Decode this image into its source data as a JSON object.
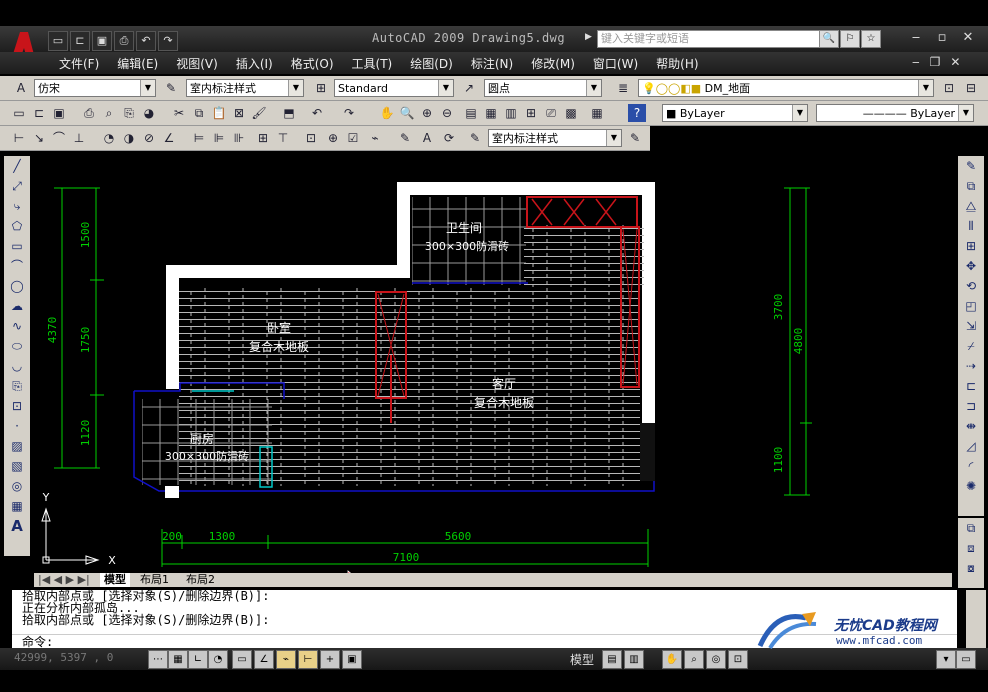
{
  "colors": {
    "accent_red": "#c8141a",
    "dim_green": "#00d000",
    "wall_white": "#ffffff",
    "hatch_gray": "#b8b8b8",
    "boundary_blue": "#1010c8",
    "canvas_black": "#000000"
  },
  "titlebar": {
    "title": "AutoCAD 2009  Drawing5.dwg",
    "search_placeholder": "键入关键字或短语",
    "quick_access_icons": [
      "new-icon",
      "open-icon",
      "save-icon",
      "print-icon",
      "undo-icon",
      "redo-icon"
    ]
  },
  "menu": {
    "items": [
      "文件(F)",
      "编辑(E)",
      "视图(V)",
      "插入(I)",
      "格式(O)",
      "工具(T)",
      "绘图(D)",
      "标注(N)",
      "修改(M)",
      "窗口(W)",
      "帮助(H)"
    ]
  },
  "toolbar": {
    "text_font": "仿宋",
    "dim_style": "室内标注样式",
    "table_style": "Standard",
    "multileader_style": "圆点",
    "layer_name": "DM_地面",
    "color": "ByLayer",
    "linetype": "ByLayer",
    "dim_style_2": "室内标注样式"
  },
  "drawing": {
    "rooms": [
      {
        "name": "卫生间",
        "material": "300×300防滑砖"
      },
      {
        "name": "卧室",
        "material": "复合木地板"
      },
      {
        "name": "客厅",
        "material": "复合木地板"
      },
      {
        "name": "厨房",
        "material": "300×300防滑砖"
      }
    ],
    "dimensions": {
      "left": [
        "1500",
        "1750",
        "1120",
        "4370"
      ],
      "right": [
        "3700",
        "1100",
        "4800"
      ],
      "bottom": [
        "200",
        "1300",
        "5600",
        "7100"
      ]
    },
    "ucs": {
      "x": "X",
      "y": "Y"
    }
  },
  "layout_tabs": [
    "模型",
    "布局1",
    "布局2"
  ],
  "command": {
    "history": [
      "拾取内部点或 [选择对象(S)/删除边界(B)]:",
      "正在分析内部孤岛...",
      "拾取内部点或 [选择对象(S)/删除边界(B)]:"
    ],
    "prompt": "命令:"
  },
  "status": {
    "coords": "42999, 5397 , 0",
    "model_label": "模型"
  },
  "watermark": {
    "text": "无忧CAD教程网",
    "url": "www.mfcad.com"
  }
}
